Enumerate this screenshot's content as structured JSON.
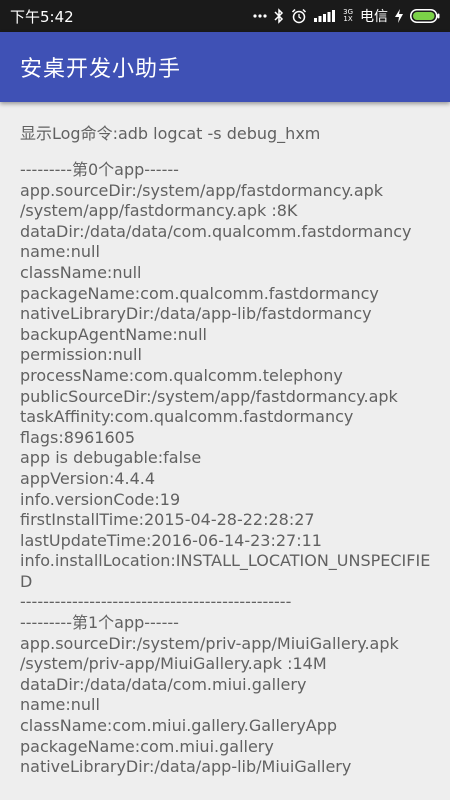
{
  "status_bar": {
    "time": "下午5:42",
    "network_top": "3G",
    "network_bottom": "1X",
    "carrier": "电信"
  },
  "app_bar": {
    "title": "安桌开发小助手"
  },
  "content": {
    "command_line": "显示Log命令:adb logcat -s debug_hxm",
    "lines": [
      "---------第0个app------",
      "app.sourceDir:/system/app/fastdormancy.apk",
      "/system/app/fastdormancy.apk :8K",
      "dataDir:/data/data/com.qualcomm.fastdormancy",
      "name:null",
      "className:null",
      "packageName:com.qualcomm.fastdormancy",
      "nativeLibraryDir:/data/app-lib/fastdormancy",
      "backupAgentName:null",
      "permission:null",
      "processName:com.qualcomm.telephony",
      "publicSourceDir:/system/app/fastdormancy.apk",
      "taskAffinity:com.qualcomm.fastdormancy",
      "flags:8961605",
      "app is debugable:false",
      "appVersion:4.4.4",
      "info.versionCode:19",
      "firstInstallTime:2015-04-28-22:28:27",
      "lastUpdateTime:2016-06-14-23:27:11",
      "info.installLocation:INSTALL_LOCATION_UNSPECIFIED",
      "-----------------------------------------------",
      "---------第1个app------",
      "app.sourceDir:/system/priv-app/MiuiGallery.apk",
      "/system/priv-app/MiuiGallery.apk :14M",
      "dataDir:/data/data/com.miui.gallery",
      "name:null",
      "className:com.miui.gallery.GalleryApp",
      "packageName:com.miui.gallery",
      "nativeLibraryDir:/data/app-lib/MiuiGallery"
    ]
  }
}
